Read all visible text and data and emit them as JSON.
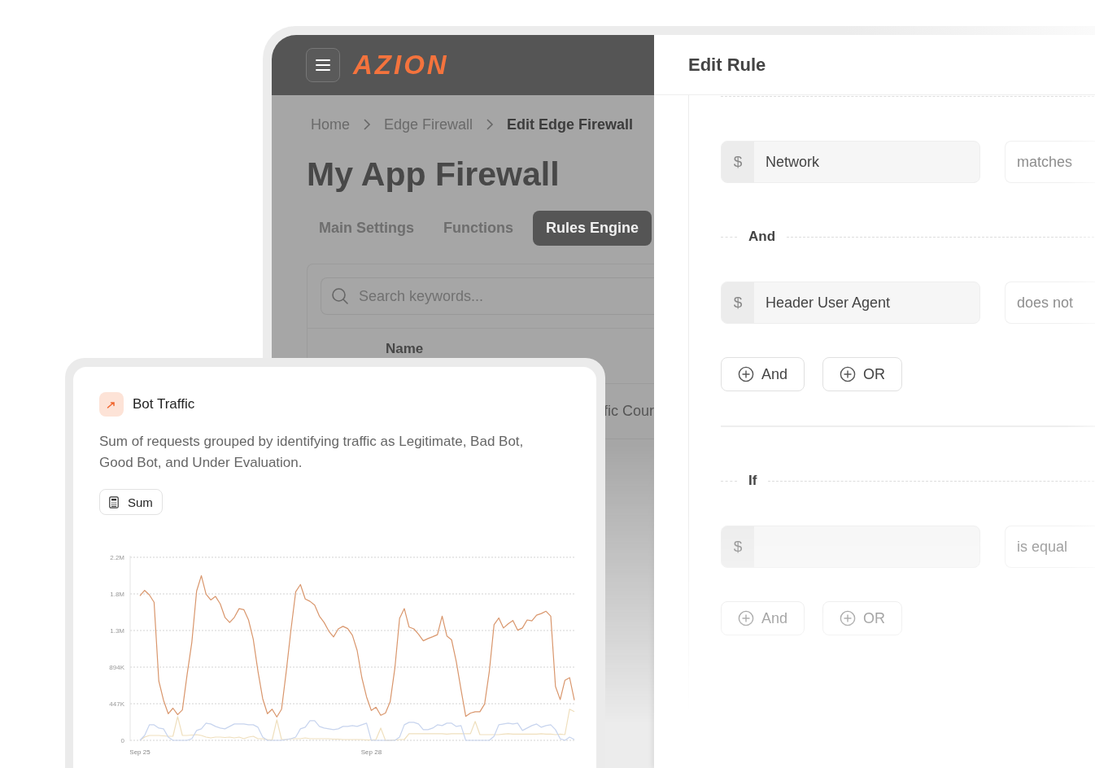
{
  "app": {
    "logo": "AZION",
    "breadcrumb": [
      {
        "label": "Home",
        "current": false
      },
      {
        "label": "Edge Firewall",
        "current": false
      },
      {
        "label": "Edit Edge Firewall",
        "current": true
      }
    ],
    "title": "My App Firewall",
    "tabs": [
      {
        "label": "Main Settings",
        "selected": false
      },
      {
        "label": "Functions",
        "selected": false
      },
      {
        "label": "Rules Engine",
        "selected": true
      }
    ],
    "search": {
      "placeholder": "Search keywords..."
    },
    "table": {
      "columns": [
        "Name"
      ],
      "rows": [
        [
          "fic Cour"
        ]
      ]
    }
  },
  "drawer": {
    "title": "Edit Rule",
    "blocks": [
      {
        "kind": "separator"
      },
      {
        "kind": "condition",
        "prefix": "$",
        "value": "Network",
        "operator": "matches"
      },
      {
        "kind": "separator",
        "label": "And"
      },
      {
        "kind": "condition",
        "prefix": "$",
        "value": "Header User Agent",
        "operator": "does not"
      },
      {
        "kind": "actions",
        "buttons": [
          "And",
          "OR"
        ]
      },
      {
        "kind": "rule"
      },
      {
        "kind": "separator",
        "label": "If"
      },
      {
        "kind": "condition",
        "prefix": "$",
        "operator": "is equal"
      },
      {
        "kind": "actions",
        "buttons": [
          "And",
          "OR"
        ]
      }
    ]
  },
  "card": {
    "title": "Bot Traffic",
    "description": "Sum of requests grouped by identifying traffic as Legitimate, Bad Bot, Good Bot, and Under Evaluation.",
    "chip": "Sum",
    "chart_data": {
      "type": "line",
      "grid": true,
      "ylim": [
        0,
        2235000
      ],
      "categories": [
        "Sep 25",
        null,
        null,
        null,
        null,
        null,
        null,
        null,
        null,
        null,
        null,
        null,
        null,
        null,
        null,
        null,
        null,
        null,
        null,
        null,
        null,
        null,
        null,
        null,
        null,
        null,
        null,
        null,
        null,
        null,
        null,
        null,
        null,
        null,
        null,
        null,
        null,
        null,
        null,
        null,
        null,
        null,
        null,
        null,
        null,
        null,
        null,
        null,
        null,
        "Sep 28",
        null,
        null,
        null,
        null,
        null,
        null,
        null,
        null,
        null,
        null,
        null,
        null,
        null,
        null,
        null,
        null,
        null,
        null,
        null,
        null,
        null,
        null,
        null,
        null,
        null,
        null,
        null,
        null,
        null,
        null,
        null,
        null,
        null,
        null,
        null,
        null,
        null,
        null,
        null,
        null,
        null,
        null,
        null
      ],
      "yticks": [
        {
          "value": 0,
          "label": "0"
        },
        {
          "value": 447000,
          "label": "447K"
        },
        {
          "value": 894000,
          "label": "894K"
        },
        {
          "value": 1341000,
          "label": "1.3M"
        },
        {
          "value": 1788000,
          "label": "1.8M"
        },
        {
          "value": 2235000,
          "label": "2.2M"
        }
      ],
      "series": [
        {
          "color": "#d9966c",
          "values": [
            1764000,
            1831000,
            1776000,
            1686000,
            725000,
            490000,
            325000,
            392000,
            314000,
            372000,
            804000,
            1196000,
            1823000,
            2011000,
            1784000,
            1714000,
            1757000,
            1666000,
            1502000,
            1439000,
            1502000,
            1608000,
            1596000,
            1470000,
            1235000,
            843000,
            510000,
            325000,
            380000,
            286000,
            380000,
            843000,
            1353000,
            1815000,
            1902000,
            1725000,
            1698000,
            1651000,
            1517000,
            1439000,
            1333000,
            1263000,
            1361000,
            1392000,
            1365000,
            1282000,
            1098000,
            765000,
            529000,
            365000,
            404000,
            306000,
            333000,
            471000,
            882000,
            1490000,
            1608000,
            1384000,
            1361000,
            1294000,
            1216000,
            1243000,
            1266000,
            1290000,
            1517000,
            1274000,
            1227000,
            961000,
            620000,
            294000,
            333000,
            349000,
            349000,
            443000,
            843000,
            1412000,
            1494000,
            1372000,
            1423000,
            1463000,
            1345000,
            1372000,
            1470000,
            1459000,
            1529000,
            1549000,
            1576000,
            1517000,
            659000,
            498000,
            733000,
            765000,
            490000
          ]
        },
        {
          "color": "#c7d4ee",
          "values": [
            0,
            60000,
            190000,
            190000,
            150000,
            140000,
            40000,
            0,
            0,
            0,
            0,
            20000,
            120000,
            140000,
            210000,
            200000,
            170000,
            150000,
            140000,
            170000,
            200000,
            200000,
            200000,
            190000,
            190000,
            160000,
            40000,
            0,
            0,
            0,
            0,
            10000,
            20000,
            40000,
            140000,
            160000,
            240000,
            240000,
            170000,
            150000,
            140000,
            130000,
            140000,
            170000,
            170000,
            180000,
            170000,
            190000,
            210000,
            0,
            0,
            0,
            0,
            0,
            0,
            40000,
            190000,
            220000,
            220000,
            200000,
            130000,
            130000,
            150000,
            190000,
            180000,
            210000,
            210000,
            170000,
            180000,
            0,
            0,
            0,
            0,
            0,
            0,
            50000,
            190000,
            200000,
            210000,
            200000,
            210000,
            120000,
            150000,
            180000,
            200000,
            160000,
            180000,
            190000,
            130000,
            20000,
            0,
            40000,
            10000
          ]
        },
        {
          "color": "#efdfbd",
          "values": [
            0,
            40000,
            60000,
            60000,
            60000,
            55000,
            50000,
            50000,
            290000,
            60000,
            60000,
            65000,
            70000,
            60000,
            40000,
            30000,
            40000,
            40000,
            35000,
            40000,
            30000,
            40000,
            20000,
            40000,
            50000,
            20000,
            20000,
            10000,
            5000,
            250000,
            10000,
            10000,
            20000,
            20000,
            20000,
            30000,
            20000,
            20000,
            20000,
            20000,
            20000,
            15000,
            15000,
            10000,
            10000,
            10000,
            10000,
            10000,
            5000,
            5000,
            10000,
            150000,
            0,
            0,
            5000,
            10000,
            10000,
            80000,
            80000,
            80000,
            80000,
            80000,
            80000,
            80000,
            80000,
            75000,
            80000,
            80000,
            80000,
            80000,
            80000,
            230000,
            70000,
            70000,
            70000,
            70000,
            70000,
            75000,
            80000,
            75000,
            75000,
            75000,
            75000,
            75000,
            75000,
            80000,
            75000,
            75000,
            70000,
            75000,
            70000,
            380000,
            350000
          ]
        }
      ]
    }
  }
}
